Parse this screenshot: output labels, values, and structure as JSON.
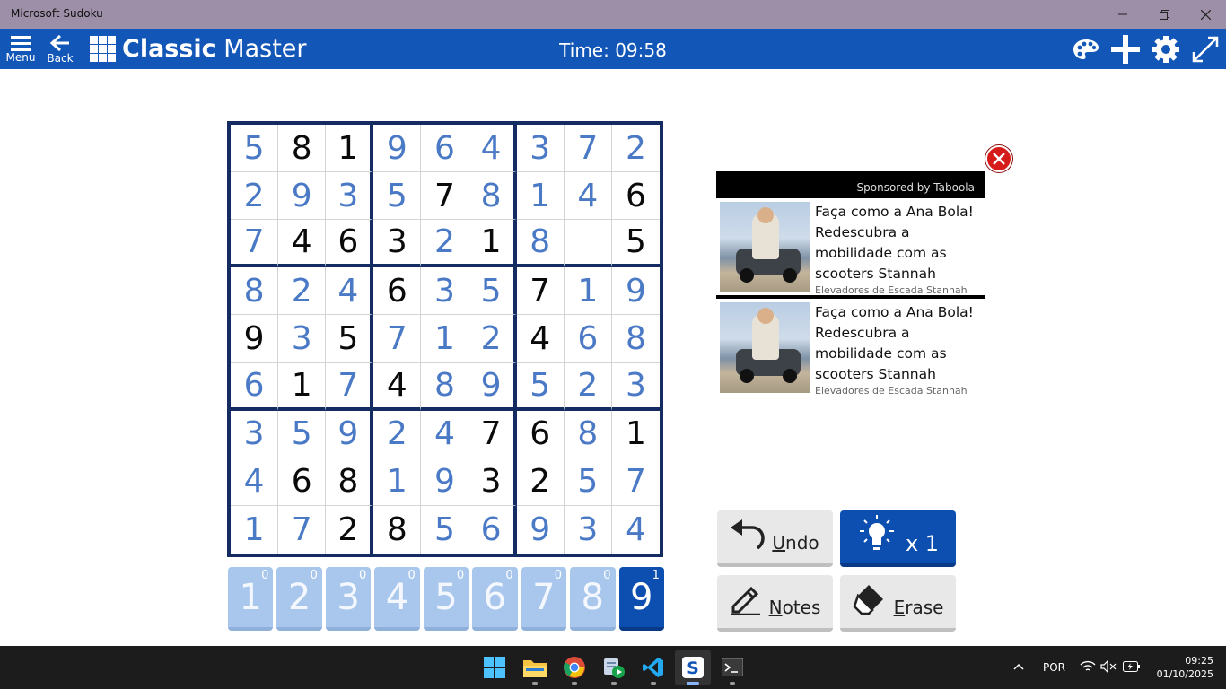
{
  "window": {
    "title": "Microsoft Sudoku"
  },
  "header": {
    "menu_label": "Menu",
    "back_label": "Back",
    "title_bold": "Classic",
    "title_rest": "Master",
    "timer": "Time: 09:58"
  },
  "board": {
    "rows": [
      [
        "5",
        "8",
        "1",
        "9",
        "6",
        "4",
        "3",
        "7",
        "2"
      ],
      [
        "2",
        "9",
        "3",
        "5",
        "7",
        "8",
        "1",
        "4",
        "6"
      ],
      [
        "7",
        "4",
        "6",
        "3",
        "2",
        "1",
        "8",
        "",
        "5"
      ],
      [
        "8",
        "2",
        "4",
        "6",
        "3",
        "5",
        "7",
        "1",
        "9"
      ],
      [
        "9",
        "3",
        "5",
        "7",
        "1",
        "2",
        "4",
        "6",
        "8"
      ],
      [
        "6",
        "1",
        "7",
        "4",
        "8",
        "9",
        "5",
        "2",
        "3"
      ],
      [
        "3",
        "5",
        "9",
        "2",
        "4",
        "7",
        "6",
        "8",
        "1"
      ],
      [
        "4",
        "6",
        "8",
        "1",
        "9",
        "3",
        "2",
        "5",
        "7"
      ],
      [
        "1",
        "7",
        "2",
        "8",
        "5",
        "6",
        "9",
        "3",
        "4"
      ]
    ],
    "given": [
      "011000000",
      "000010001",
      "011101001",
      "000100100",
      "101000100",
      "010100000",
      "000001101",
      "011001100",
      "001100000"
    ]
  },
  "numpad": [
    {
      "digit": "1",
      "remaining": "0"
    },
    {
      "digit": "2",
      "remaining": "0"
    },
    {
      "digit": "3",
      "remaining": "0"
    },
    {
      "digit": "4",
      "remaining": "0"
    },
    {
      "digit": "5",
      "remaining": "0"
    },
    {
      "digit": "6",
      "remaining": "0"
    },
    {
      "digit": "7",
      "remaining": "0"
    },
    {
      "digit": "8",
      "remaining": "0"
    },
    {
      "digit": "9",
      "remaining": "1",
      "selected": true
    }
  ],
  "ad": {
    "sponsor": "Sponsored by Taboola",
    "items": [
      {
        "headline": "Faça como a Ana Bola! Redescubra a mobilidade com as scooters Stannah",
        "source": "Elevadores de Escada Stannah"
      },
      {
        "headline": "Faça como a Ana Bola! Redescubra a mobilidade com as scooters Stannah",
        "source": "Elevadores de Escada Stannah"
      }
    ]
  },
  "actions": {
    "undo_key": "U",
    "undo_rest": "ndo",
    "hint_count": "x 1",
    "notes_key": "N",
    "notes_rest": "otes",
    "erase_key": "E",
    "erase_rest": "rase"
  },
  "taskbar": {
    "language": "POR",
    "time": "09:25",
    "date": "01/10/2025"
  },
  "colors": {
    "header_blue": "#1257b8",
    "user_digit_blue": "#4a79c6",
    "grid_border": "#152c63",
    "titlebar": "#9c8fa7"
  }
}
